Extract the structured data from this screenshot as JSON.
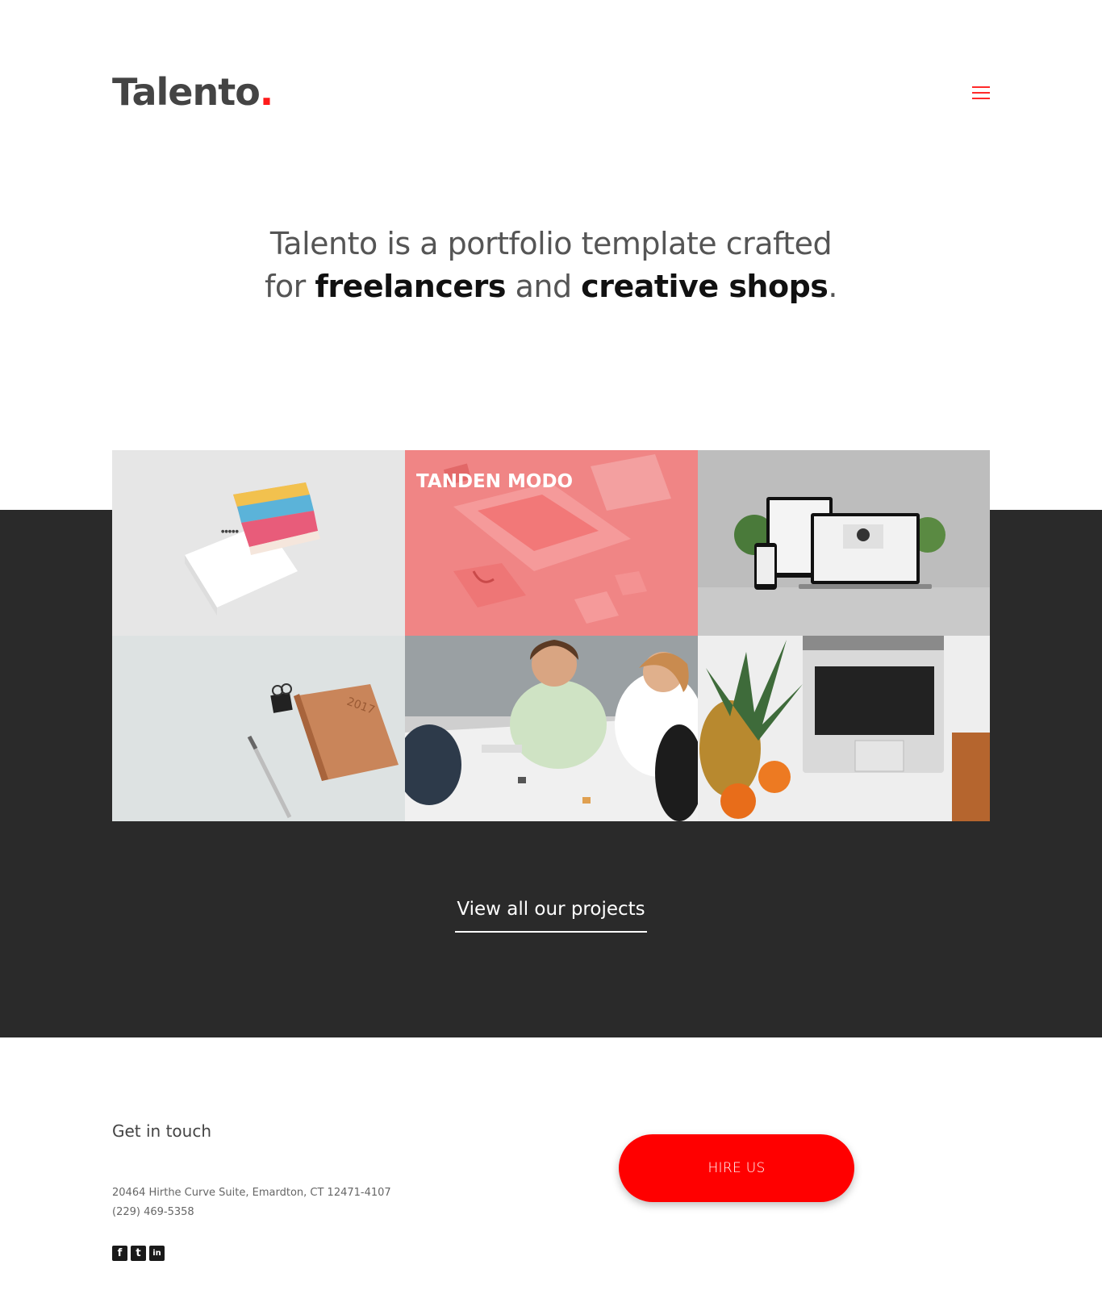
{
  "brand": {
    "name": "Talento",
    "dot": "."
  },
  "hero": {
    "line1": "Talento is a portfolio template crafted",
    "line2_start": "for ",
    "strong1": "freelancers",
    "middle": " and ",
    "strong2": "creative shops",
    "end": "."
  },
  "portfolio": {
    "tiles": [
      {
        "icon": "business-cards-photo"
      },
      {
        "title": "TANDEN MODO",
        "icon": "branding-mockup-photo"
      },
      {
        "icon": "responsive-devices-photo"
      },
      {
        "icon": "notebook-pen-photo"
      },
      {
        "icon": "team-meeting-photo"
      },
      {
        "icon": "laptop-pineapple-photo"
      }
    ],
    "view_all_label": "View all our projects"
  },
  "contact": {
    "title": "Get in touch",
    "address": "20464 Hirthe Curve Suite, Emardton, CT 12471-4107",
    "phone": "(229) 469-5358",
    "hire_label": "HIRE US",
    "social": [
      {
        "icon": "facebook-icon",
        "glyph": "f"
      },
      {
        "icon": "twitter-icon",
        "glyph": "t"
      },
      {
        "icon": "linkedin-icon",
        "glyph": "in"
      }
    ]
  },
  "colors": {
    "accent": "#ff0000",
    "dark": "#2a2a2a",
    "coral": "#f08080"
  }
}
